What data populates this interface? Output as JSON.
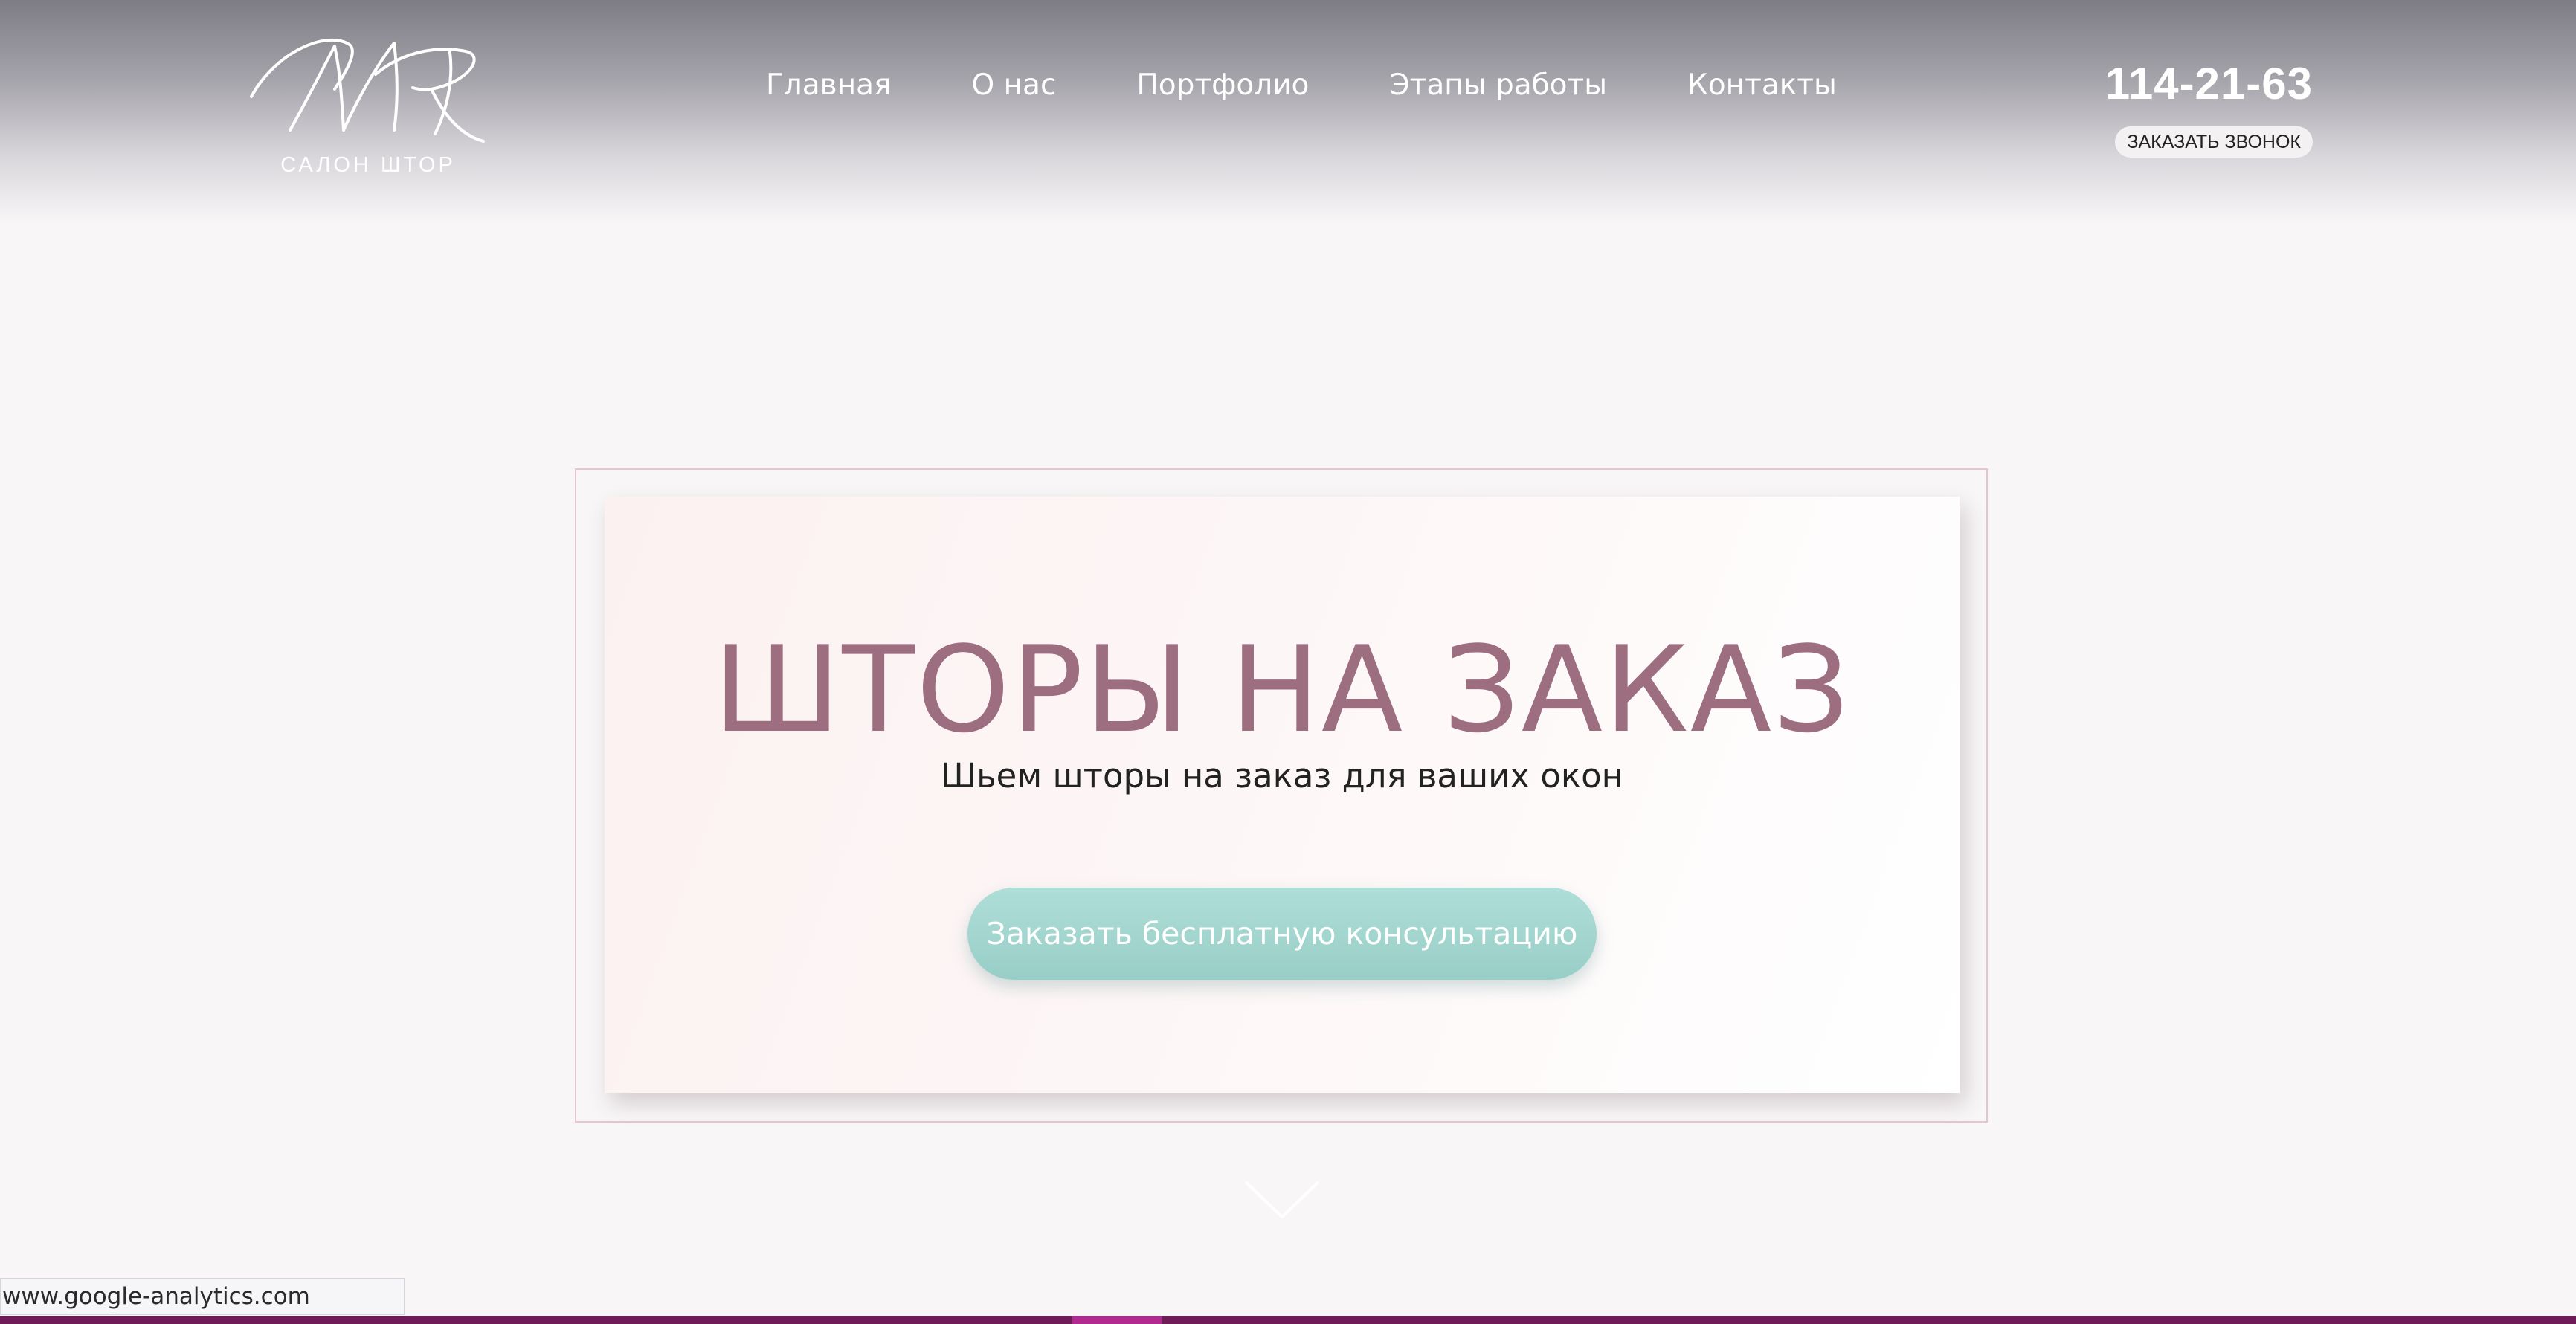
{
  "header": {
    "logo": {
      "caption": "САЛОН ШТОР",
      "icon": "script-monogram-logo"
    },
    "nav": [
      {
        "label": "Главная"
      },
      {
        "label": "О нас"
      },
      {
        "label": "Портфолио"
      },
      {
        "label": "Этапы работы"
      },
      {
        "label": "Контакты"
      }
    ],
    "phone": "114-21-63",
    "callback_label": "ЗАКАЗАТЬ ЗВОНОК"
  },
  "hero": {
    "title": "ШТОРЫ НА ЗАКАЗ",
    "subtitle": "Шьем шторы на заказ для ваших окон",
    "cta_label": "Заказать бесплатную консультацию",
    "scroll_icon": "chevron-down-icon"
  },
  "status_bar": {
    "url": "www.google-analytics.com"
  },
  "colors": {
    "title": "#9d6e80",
    "cta": "#a4d6d0",
    "frame_border": "#e5c6d0",
    "bottom_bar": "#6f1b58"
  }
}
